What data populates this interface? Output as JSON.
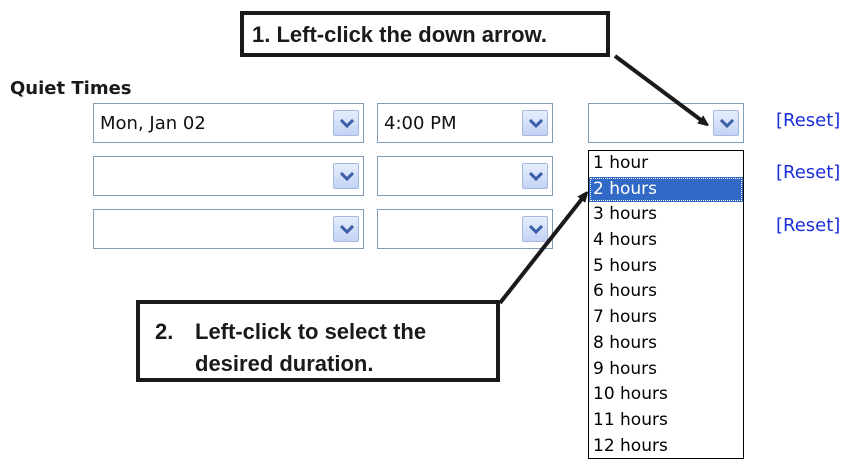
{
  "callouts": {
    "step1": "1. Left-click the down arrow.",
    "step2_number": "2.",
    "step2_line1": "Left-click to select the",
    "step2_line2": "desired duration."
  },
  "section": {
    "title": "Quiet Times"
  },
  "rows": [
    {
      "date": "Mon, Jan 02",
      "time": "4:00 PM",
      "duration": "",
      "reset": "[Reset]"
    },
    {
      "date": "",
      "time": "",
      "reset": "[Reset]"
    },
    {
      "date": "",
      "time": "",
      "reset": "[Reset]"
    }
  ],
  "duration_options": [
    "1 hour",
    "2 hours",
    "3 hours",
    "4 hours",
    "5 hours",
    "6 hours",
    "7 hours",
    "8 hours",
    "9 hours",
    "10 hours",
    "11 hours",
    "12 hours"
  ],
  "selected_duration": "2 hours",
  "colors": {
    "link": "#1b2ed8",
    "selection": "#3169c6",
    "combo_border": "#7f9db9"
  },
  "icons": {
    "dropdown_arrow": "chevron-down-icon"
  }
}
